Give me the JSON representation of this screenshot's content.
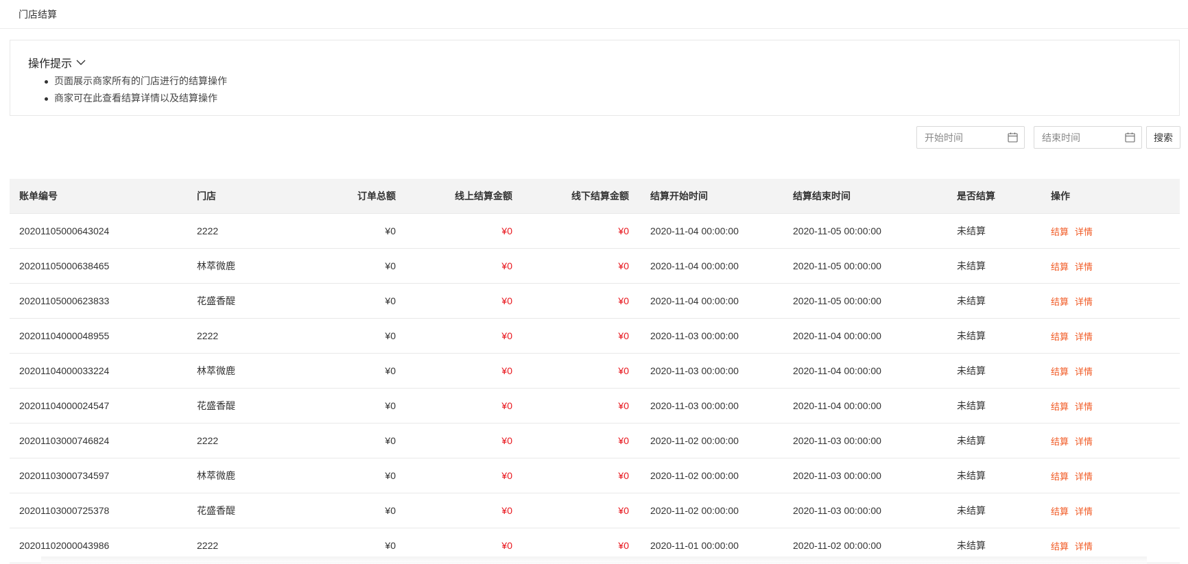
{
  "header": {
    "title": "门店结算"
  },
  "tips": {
    "title": "操作提示",
    "items": [
      "页面展示商家所有的门店进行的结算操作",
      "商家可在此查看结算详情以及结算操作"
    ]
  },
  "filters": {
    "start_placeholder": "开始时间",
    "end_placeholder": "结束时间",
    "search_label": "搜索"
  },
  "table": {
    "columns": [
      "账单编号",
      "门店",
      "订单总额",
      "线上结算金额",
      "线下结算金额",
      "结算开始时间",
      "结算结束时间",
      "是否结算",
      "操作"
    ],
    "rows": [
      {
        "id": "20201105000643024",
        "store": "2222",
        "total": "¥0",
        "online": "¥0",
        "offline": "¥0",
        "start": "2020-11-04 00:00:00",
        "end": "2020-11-05 00:00:00",
        "status": "未结算",
        "settle": "结算",
        "detail": "详情"
      },
      {
        "id": "20201105000638465",
        "store": "林萃微鹿",
        "total": "¥0",
        "online": "¥0",
        "offline": "¥0",
        "start": "2020-11-04 00:00:00",
        "end": "2020-11-05 00:00:00",
        "status": "未结算",
        "settle": "结算",
        "detail": "详情"
      },
      {
        "id": "20201105000623833",
        "store": "花盛香醍",
        "total": "¥0",
        "online": "¥0",
        "offline": "¥0",
        "start": "2020-11-04 00:00:00",
        "end": "2020-11-05 00:00:00",
        "status": "未结算",
        "settle": "结算",
        "detail": "详情"
      },
      {
        "id": "20201104000048955",
        "store": "2222",
        "total": "¥0",
        "online": "¥0",
        "offline": "¥0",
        "start": "2020-11-03 00:00:00",
        "end": "2020-11-04 00:00:00",
        "status": "未结算",
        "settle": "结算",
        "detail": "详情"
      },
      {
        "id": "20201104000033224",
        "store": "林萃微鹿",
        "total": "¥0",
        "online": "¥0",
        "offline": "¥0",
        "start": "2020-11-03 00:00:00",
        "end": "2020-11-04 00:00:00",
        "status": "未结算",
        "settle": "结算",
        "detail": "详情"
      },
      {
        "id": "20201104000024547",
        "store": "花盛香醍",
        "total": "¥0",
        "online": "¥0",
        "offline": "¥0",
        "start": "2020-11-03 00:00:00",
        "end": "2020-11-04 00:00:00",
        "status": "未结算",
        "settle": "结算",
        "detail": "详情"
      },
      {
        "id": "20201103000746824",
        "store": "2222",
        "total": "¥0",
        "online": "¥0",
        "offline": "¥0",
        "start": "2020-11-02 00:00:00",
        "end": "2020-11-03 00:00:00",
        "status": "未结算",
        "settle": "结算",
        "detail": "详情"
      },
      {
        "id": "20201103000734597",
        "store": "林萃微鹿",
        "total": "¥0",
        "online": "¥0",
        "offline": "¥0",
        "start": "2020-11-02 00:00:00",
        "end": "2020-11-03 00:00:00",
        "status": "未结算",
        "settle": "结算",
        "detail": "详情"
      },
      {
        "id": "20201103000725378",
        "store": "花盛香醍",
        "total": "¥0",
        "online": "¥0",
        "offline": "¥0",
        "start": "2020-11-02 00:00:00",
        "end": "2020-11-03 00:00:00",
        "status": "未结算",
        "settle": "结算",
        "detail": "详情"
      },
      {
        "id": "20201102000043986",
        "store": "2222",
        "total": "¥0",
        "online": "¥0",
        "offline": "¥0",
        "start": "2020-11-01 00:00:00",
        "end": "2020-11-02 00:00:00",
        "status": "未结算",
        "settle": "结算",
        "detail": "详情"
      }
    ]
  },
  "colors": {
    "amount_red": "#e8141b",
    "action_orange": "#f15a24",
    "header_bg": "#f3f3f3"
  },
  "icons": {
    "tips_toggle": "chevron-down-icon",
    "date_picker": "calendar-icon"
  }
}
